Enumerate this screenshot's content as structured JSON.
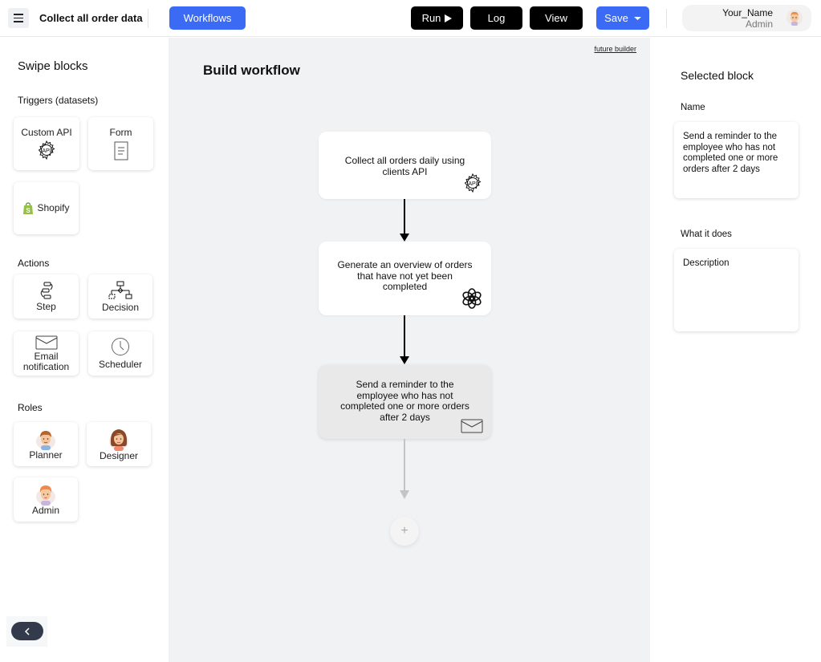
{
  "header": {
    "menu_icon": "hamburger-menu-icon",
    "title": "Collect all order data",
    "workflows_label": "Workflows",
    "run_label": "Run",
    "run_icon": "play-icon",
    "log_label": "Log",
    "view_label": "View",
    "save_label": "Save",
    "save_icon": "caret-down-icon",
    "user": {
      "name": "Your_Name",
      "role": "Admin",
      "avatar": "admin-avatar"
    }
  },
  "colors": {
    "primary": "#3b6bf5",
    "dark_button": "#000000",
    "canvas_bg": "#f1f2f4",
    "collapse_button": "#323a4c"
  },
  "sidebar": {
    "title": "Swipe blocks",
    "triggers": {
      "heading": "Triggers (datasets)",
      "items": [
        {
          "label": "Custom API",
          "icon": "api-gear-icon"
        },
        {
          "label": "Form",
          "icon": "form-document-icon"
        },
        {
          "label": "Shopify",
          "icon": "shopify-bag-icon"
        }
      ]
    },
    "actions": {
      "heading": "Actions",
      "items": [
        {
          "label": "Step",
          "icon": "step-flow-icon"
        },
        {
          "label": "Decision",
          "icon": "decision-tree-icon"
        },
        {
          "label": "Email notification",
          "icon": "envelope-icon"
        },
        {
          "label": "Scheduler",
          "icon": "clock-icon"
        }
      ]
    },
    "roles": {
      "heading": "Roles",
      "items": [
        {
          "label": "Planner",
          "icon": "planner-avatar"
        },
        {
          "label": "Designer",
          "icon": "designer-avatar"
        },
        {
          "label": "Admin",
          "icon": "admin-avatar"
        }
      ]
    },
    "collapse_icon": "chevron-left-icon"
  },
  "canvas": {
    "title": "Build workflow",
    "future_link": "future builder",
    "nodes": [
      {
        "text": "Collect all orders daily using clients API",
        "icon": "api-gear-icon",
        "selected": false
      },
      {
        "text": "Generate an overview of orders that have not yet been completed",
        "icon": "openai-logo-icon",
        "selected": false
      },
      {
        "text": "Send a reminder to the employee who has not completed one or more orders after 2 days",
        "icon": "envelope-icon",
        "selected": true
      }
    ],
    "add_label": "+"
  },
  "selected_block": {
    "title": "Selected block",
    "name_label": "Name",
    "name_value": "Send a reminder to the employee who has not completed one or more orders after 2 days",
    "what_label": "What it does",
    "description_placeholder": "Description"
  }
}
